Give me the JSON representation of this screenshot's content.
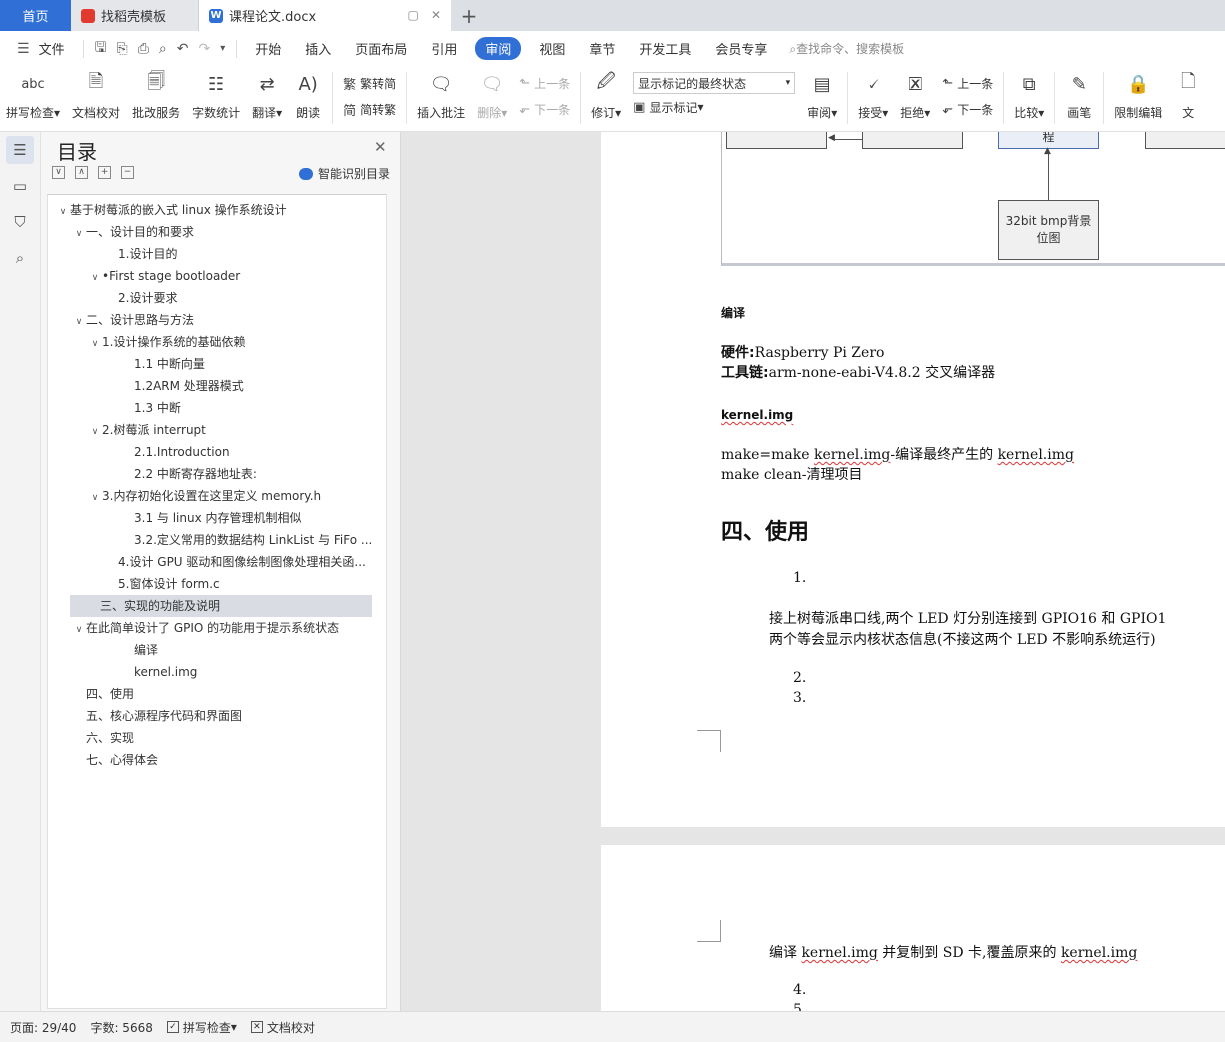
{
  "tabs": {
    "home": "首页",
    "wps": "找稻壳模板",
    "doc": "课程论文.docx",
    "add": "+"
  },
  "menu": {
    "file": "文件",
    "items": [
      "开始",
      "插入",
      "页面布局",
      "引用",
      "审阅",
      "视图",
      "章节",
      "开发工具",
      "会员专享"
    ],
    "active": "审阅",
    "search": "查找命令、搜索模板"
  },
  "ribbon": {
    "spell": "拼写检查",
    "proof": "文档校对",
    "annot_service": "批改服务",
    "wordcount": "字数统计",
    "translate": "翻译",
    "read": "朗读",
    "trad_to_simp": "繁转简",
    "simp_to_trad": "简转繁",
    "insert_comment": "插入批注",
    "delete": "删除",
    "prev": "上一条",
    "next": "下一条",
    "revise": "修订",
    "markup_select": "显示标记的最终状态",
    "show_markup": "显示标记",
    "review": "审阅",
    "accept": "接受",
    "reject": "拒绝",
    "prev2": "上一条",
    "next2": "下一条",
    "compare": "比较",
    "pen": "画笔",
    "restrict": "限制编辑",
    "doc_cut": "文"
  },
  "toc": {
    "title": "目录",
    "smart": "智能识别目录",
    "items": [
      {
        "text": "基于树莓派的嵌入式 linux 操作系统设计",
        "level": 0,
        "caret": "v"
      },
      {
        "text": "一、设计目的和要求",
        "level": 1,
        "caret": "v"
      },
      {
        "text": "1.设计目的",
        "level": 3,
        "caret": ""
      },
      {
        "text": "•First stage bootloader",
        "level": 2,
        "caret": "v"
      },
      {
        "text": "2.设计要求",
        "level": 3,
        "caret": ""
      },
      {
        "text": "二、设计思路与方法",
        "level": 1,
        "caret": "v"
      },
      {
        "text": "1.设计操作系统的基础依赖",
        "level": 2,
        "caret": "v"
      },
      {
        "text": "1.1 中断向量",
        "level": 4,
        "caret": ""
      },
      {
        "text": "1.2ARM 处理器模式",
        "level": 4,
        "caret": ""
      },
      {
        "text": "1.3 中断",
        "level": 4,
        "caret": ""
      },
      {
        "text": "2.树莓派 interrupt",
        "level": 2,
        "caret": "v"
      },
      {
        "text": "2.1.Introduction",
        "level": 4,
        "caret": ""
      },
      {
        "text": "2.2 中断寄存器地址表:",
        "level": 4,
        "caret": ""
      },
      {
        "text": "3.内存初始化设置在这里定义 memory.h",
        "level": 2,
        "caret": "v"
      },
      {
        "text": "3.1 与 linux 内存管理机制相似",
        "level": 4,
        "caret": ""
      },
      {
        "text": "3.2.定义常用的数据结构 LinkList 与 FiFo ...",
        "level": 4,
        "caret": ""
      },
      {
        "text": "4.设计 GPU 驱动和图像绘制图像处理相关函...",
        "level": 3,
        "caret": ""
      },
      {
        "text": "5.窗体设计 form.c",
        "level": 3,
        "caret": ""
      },
      {
        "text": "三、实现的功能及说明",
        "level": 1,
        "caret": "",
        "selected": true
      },
      {
        "text": "在此简单设计了 GPIO 的功能用于提示系统状态",
        "level": 1,
        "caret": "v"
      },
      {
        "text": "编译",
        "level": 4,
        "caret": ""
      },
      {
        "text": "kernel.img",
        "level": 4,
        "caret": ""
      },
      {
        "text": "四、使用",
        "level": 1,
        "caret": ""
      },
      {
        "text": "五、核心源程序代码和界面图",
        "level": 1,
        "caret": ""
      },
      {
        "text": "六、实现",
        "level": 1,
        "caret": ""
      },
      {
        "text": "七、心得体会",
        "level": 1,
        "caret": ""
      }
    ]
  },
  "doc": {
    "node_partial": "程",
    "node_bmp": "32bit bmp背景位图",
    "heading_compile": "编译",
    "hw_label": "硬件:",
    "hw_value": "Raspberry Pi Zero",
    "tc_label": "工具链:",
    "tc_value": "arm-none-eabi-V4.8.2 交叉编译器",
    "kernel_heading": "kernel.img",
    "make_line_a": "make=make ",
    "make_line_b": "kernel.img",
    "make_line_c": "-编译最终产生的 ",
    "make_line_d": "kernel.img",
    "clean_line": "make clean-清理项目",
    "section4": "四、使用",
    "list1": "1.",
    "para1": "接上树莓派串口线,两个 LED 灯分别连接到 GPIO16 和 GPIO1",
    "para2": "两个等会显示内核状态信息(不接这两个 LED 不影响系统运行)",
    "list2": "2.",
    "list3": "3.",
    "p2_a": "编译 ",
    "p2_b": "kernel.img",
    "p2_c": " 并复制到 SD 卡,覆盖原来的 ",
    "p2_d": "kernel.img",
    "list4": "4.",
    "list5": "5."
  },
  "status": {
    "page": "页面: 29/40",
    "words": "字数: 5668",
    "spell": "拼写检查",
    "proof": "文档校对"
  }
}
